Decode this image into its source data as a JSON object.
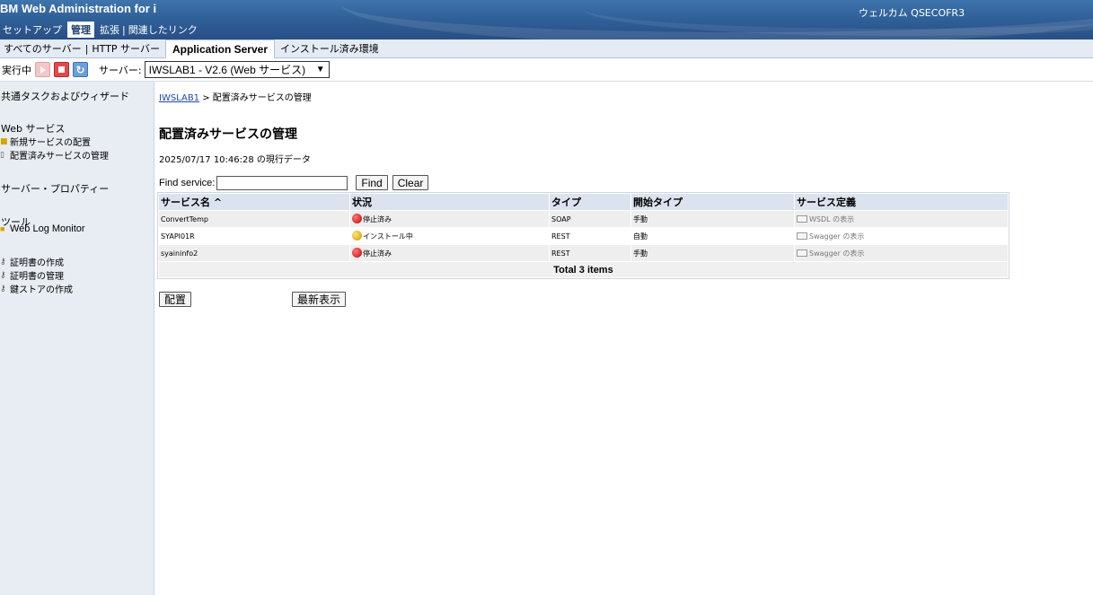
{
  "banner": {
    "title": "BM Web Administration for i",
    "welcome": "ウェルカム  QSECOFR3",
    "nav": [
      {
        "label": "セットアップ",
        "active": false
      },
      {
        "label": "管理",
        "active": true
      },
      {
        "label": "拡張",
        "active": false
      },
      {
        "label": "関連したリンク",
        "active": false
      }
    ]
  },
  "sub_tabs": [
    {
      "label": "すべてのサーバー",
      "active": false
    },
    {
      "label": "HTTP サーバー",
      "active": false
    },
    {
      "label": "Application Server",
      "active": true
    },
    {
      "label": "インストール済み環境",
      "active": false
    }
  ],
  "server_bar": {
    "status": "実行中",
    "server_label": "サーバー:",
    "server_value": "IWSLAB1 - V2.6 (Web サービス)"
  },
  "sidebar": {
    "common_tasks": "共通タスクおよびウィザード",
    "web_services": "Web サービス",
    "deploy_new": "新規サービスの配置",
    "manage_deployed": "配置済みサービスの管理",
    "server_properties": "サーバー・プロパティー",
    "tools": "ツール",
    "web_log_monitor": "Web Log Monitor",
    "create_cert": "証明書の作成",
    "manage_cert": "証明書の管理",
    "create_keystore": "鍵ストアの作成"
  },
  "main": {
    "breadcrumb_link": "IWSLAB1",
    "breadcrumb_rest": " > 配置済みサービスの管理",
    "title": "配置済みサービスの管理",
    "timestamp": "2025/07/17 10:46:28 の現行データ",
    "find_label": "Find service:",
    "find_value": "",
    "find_button": "Find",
    "clear_button": "Clear",
    "columns": [
      "サービス名 ^",
      "状況",
      "タイプ",
      "開始タイプ",
      "サービス定義"
    ],
    "rows": [
      {
        "name": "ConvertTemp",
        "status": "停止済み",
        "status_kind": "stopped",
        "type": "SOAP",
        "start_type": "手動",
        "definition": "WSDL の表示"
      },
      {
        "name": "SYAPI01R",
        "status": "インストール中",
        "status_kind": "installing",
        "type": "REST",
        "start_type": "自動",
        "definition": "Swagger の表示"
      },
      {
        "name": "syaininfo2",
        "status": "停止済み",
        "status_kind": "stopped",
        "type": "REST",
        "start_type": "手動",
        "definition": "Swagger の表示"
      }
    ],
    "total": "Total 3 items",
    "deploy_button": "配置",
    "refresh_button": "最新表示"
  }
}
